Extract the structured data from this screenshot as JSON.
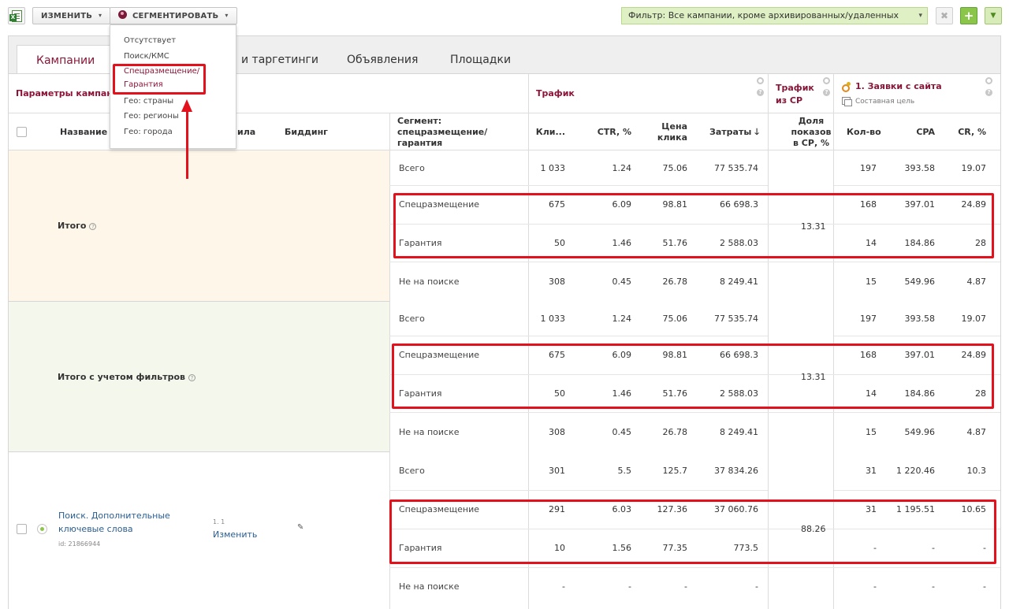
{
  "toolbar": {
    "edit_label": "ИЗМЕНИТЬ",
    "segment_label": "СЕГМЕНТИРОВАТЬ",
    "filter_text": "Фильтр: Все кампании, кроме архивированных/удаленных",
    "clear_symbol": "✖",
    "add_symbol": "+",
    "more_symbol": "▼",
    "excel_icon": "excel-export-icon"
  },
  "segment_menu": {
    "items": [
      "Отсутствует",
      "Поиск/КМС",
      "Спецразмещение/ Гарантия",
      "Гео: страны",
      "Гео: регионы",
      "Гео: города"
    ],
    "selected": "Спецразмещение/ Гарантия"
  },
  "tabs": [
    {
      "label": "Кампании"
    },
    {
      "label": "и таргетинги"
    },
    {
      "label": "Объявления"
    },
    {
      "label": "Площадки"
    }
  ],
  "groups": {
    "params": "Параметры кампании",
    "traffic": "Трафик",
    "sp_traffic": "Трафик из СР",
    "goal": "1. Заявки с сайта",
    "goal_sub": "Составная цель"
  },
  "columns": {
    "name": "Название",
    "rules": "ила",
    "bidding": "Биддинг",
    "segment": "Сегмент: спецразмещение/ гарантия",
    "clicks": "Кли...",
    "ctr": "CTR, %",
    "cpc": "Цена клика",
    "cost": "Затраты",
    "sp_share": "Доля показов в СР, %",
    "count": "Кол-во",
    "cpa": "CPA",
    "cr": "CR, %"
  },
  "blocks": [
    {
      "label": "Итого",
      "sp_share": "13.31",
      "rows": [
        {
          "segment": "Всего",
          "clicks": "1 033",
          "ctr": "1.24",
          "cpc": "75.06",
          "cost": "77 535.74",
          "count": "197",
          "cpa": "393.58",
          "cr": "19.07"
        },
        {
          "segment": "Спецразмещение",
          "clicks": "675",
          "ctr": "6.09",
          "cpc": "98.81",
          "cost": "66 698.3",
          "count": "168",
          "cpa": "397.01",
          "cr": "24.89"
        },
        {
          "segment": "Гарантия",
          "clicks": "50",
          "ctr": "1.46",
          "cpc": "51.76",
          "cost": "2 588.03",
          "count": "14",
          "cpa": "184.86",
          "cr": "28"
        },
        {
          "segment": "Не на поиске",
          "clicks": "308",
          "ctr": "0.45",
          "cpc": "26.78",
          "cost": "8 249.41",
          "count": "15",
          "cpa": "549.96",
          "cr": "4.87"
        }
      ]
    },
    {
      "label": "Итого с учетом фильтров",
      "sp_share": "13.31",
      "rows": [
        {
          "segment": "Всего",
          "clicks": "1 033",
          "ctr": "1.24",
          "cpc": "75.06",
          "cost": "77 535.74",
          "count": "197",
          "cpa": "393.58",
          "cr": "19.07"
        },
        {
          "segment": "Спецразмещение",
          "clicks": "675",
          "ctr": "6.09",
          "cpc": "98.81",
          "cost": "66 698.3",
          "count": "168",
          "cpa": "397.01",
          "cr": "24.89"
        },
        {
          "segment": "Гарантия",
          "clicks": "50",
          "ctr": "1.46",
          "cpc": "51.76",
          "cost": "2 588.03",
          "count": "14",
          "cpa": "184.86",
          "cr": "28"
        },
        {
          "segment": "Не на поиске",
          "clicks": "308",
          "ctr": "0.45",
          "cpc": "26.78",
          "cost": "8 249.41",
          "count": "15",
          "cpa": "549.96",
          "cr": "4.87"
        }
      ]
    },
    {
      "campaign_name_line1": "Поиск. Дополнительные",
      "campaign_name_line2": "ключевые слова",
      "campaign_id": "id: 21866944",
      "rules_value": "1. 1",
      "rules_link": "Изменить",
      "sp_share": "88.26",
      "rows": [
        {
          "segment": "Всего",
          "clicks": "301",
          "ctr": "5.5",
          "cpc": "125.7",
          "cost": "37 834.26",
          "count": "31",
          "cpa": "1 220.46",
          "cr": "10.3"
        },
        {
          "segment": "Спецразмещение",
          "clicks": "291",
          "ctr": "6.03",
          "cpc": "127.36",
          "cost": "37 060.76",
          "count": "31",
          "cpa": "1 195.51",
          "cr": "10.65"
        },
        {
          "segment": "Гарантия",
          "clicks": "10",
          "ctr": "1.56",
          "cpc": "77.35",
          "cost": "773.5",
          "count": "-",
          "cpa": "-",
          "cr": "-"
        },
        {
          "segment": "Не на поиске",
          "clicks": "-",
          "ctr": "-",
          "cpc": "-",
          "cost": "-",
          "count": "-",
          "cpa": "-",
          "cr": "-"
        }
      ]
    }
  ],
  "colors": {
    "accent": "#8b1538",
    "highlight_red": "#e3111b",
    "filter_green": "#dff0c4",
    "band_beige": "#fdf6e9",
    "band_green": "#f4f7ec"
  }
}
